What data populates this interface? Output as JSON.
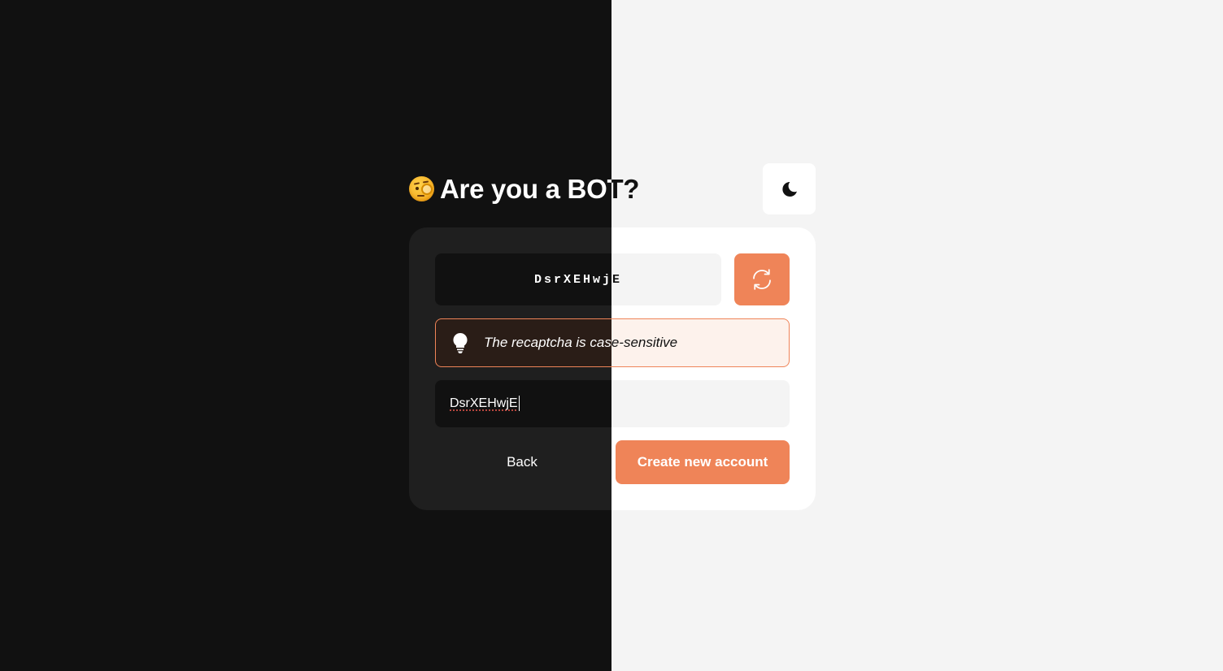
{
  "page": {
    "title": "Are you a BOT?",
    "title_emoji": "face-with-monocle-icon"
  },
  "theme_toggle": {
    "icon": "moon-icon"
  },
  "captcha": {
    "code": "DsrXEHwjE",
    "refresh_icon": "refresh-icon"
  },
  "hint": {
    "icon": "lightbulb-icon",
    "text": "The recaptcha is case-sensitive"
  },
  "answer_input": {
    "value": "DsrXEHwjE"
  },
  "actions": {
    "back_label": "Back",
    "create_label": "Create new account"
  },
  "colors": {
    "accent": "#ef8458",
    "dark_bg": "#111111",
    "dark_surface": "#1f1f1f",
    "light_bg": "#f4f4f4",
    "light_surface": "#ffffff"
  }
}
